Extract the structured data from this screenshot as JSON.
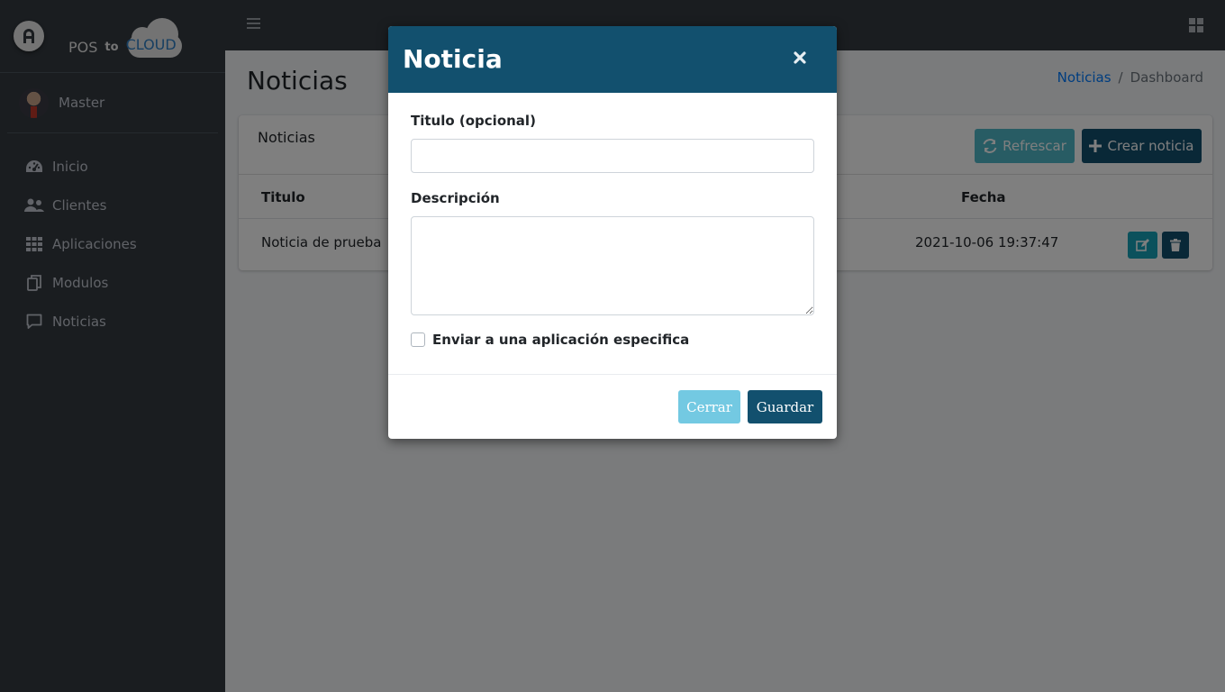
{
  "brand": {
    "pos": "POS",
    "to": "to",
    "cloud": "CLOUD",
    "logo_letter": "A"
  },
  "user": {
    "name": "Master"
  },
  "sidebar": {
    "items": [
      {
        "label": "Inicio",
        "icon": "tachometer-icon"
      },
      {
        "label": "Clientes",
        "icon": "users-icon"
      },
      {
        "label": "Aplicaciones",
        "icon": "grid-icon"
      },
      {
        "label": "Modulos",
        "icon": "copy-icon"
      },
      {
        "label": "Noticias",
        "icon": "comment-icon"
      }
    ]
  },
  "page": {
    "title": "Noticias",
    "breadcrumb": {
      "link": "Noticias",
      "separator": "/",
      "active": "Dashboard"
    }
  },
  "card": {
    "title": "Noticias",
    "refresh_label": "Refrescar",
    "create_label": "Crear noticia",
    "columns": {
      "title": "Titulo",
      "date": "Fecha"
    },
    "rows": [
      {
        "title": "Noticia de prueba",
        "date": "2021-10-06 19:37:47"
      }
    ]
  },
  "modal": {
    "title": "Noticia",
    "close_symbol": "×",
    "title_label": "Titulo (opcional)",
    "title_value": "",
    "description_label": "Descripción",
    "description_value": "",
    "checkbox_label": "Enviar a una aplicación especifica",
    "checkbox_checked": false,
    "cancel_label": "Cerrar",
    "save_label": "Guardar"
  },
  "colors": {
    "sidebar_bg": "#343a40",
    "primary_dark": "#12506e",
    "info": "#17a2b8",
    "link": "#007bff"
  }
}
